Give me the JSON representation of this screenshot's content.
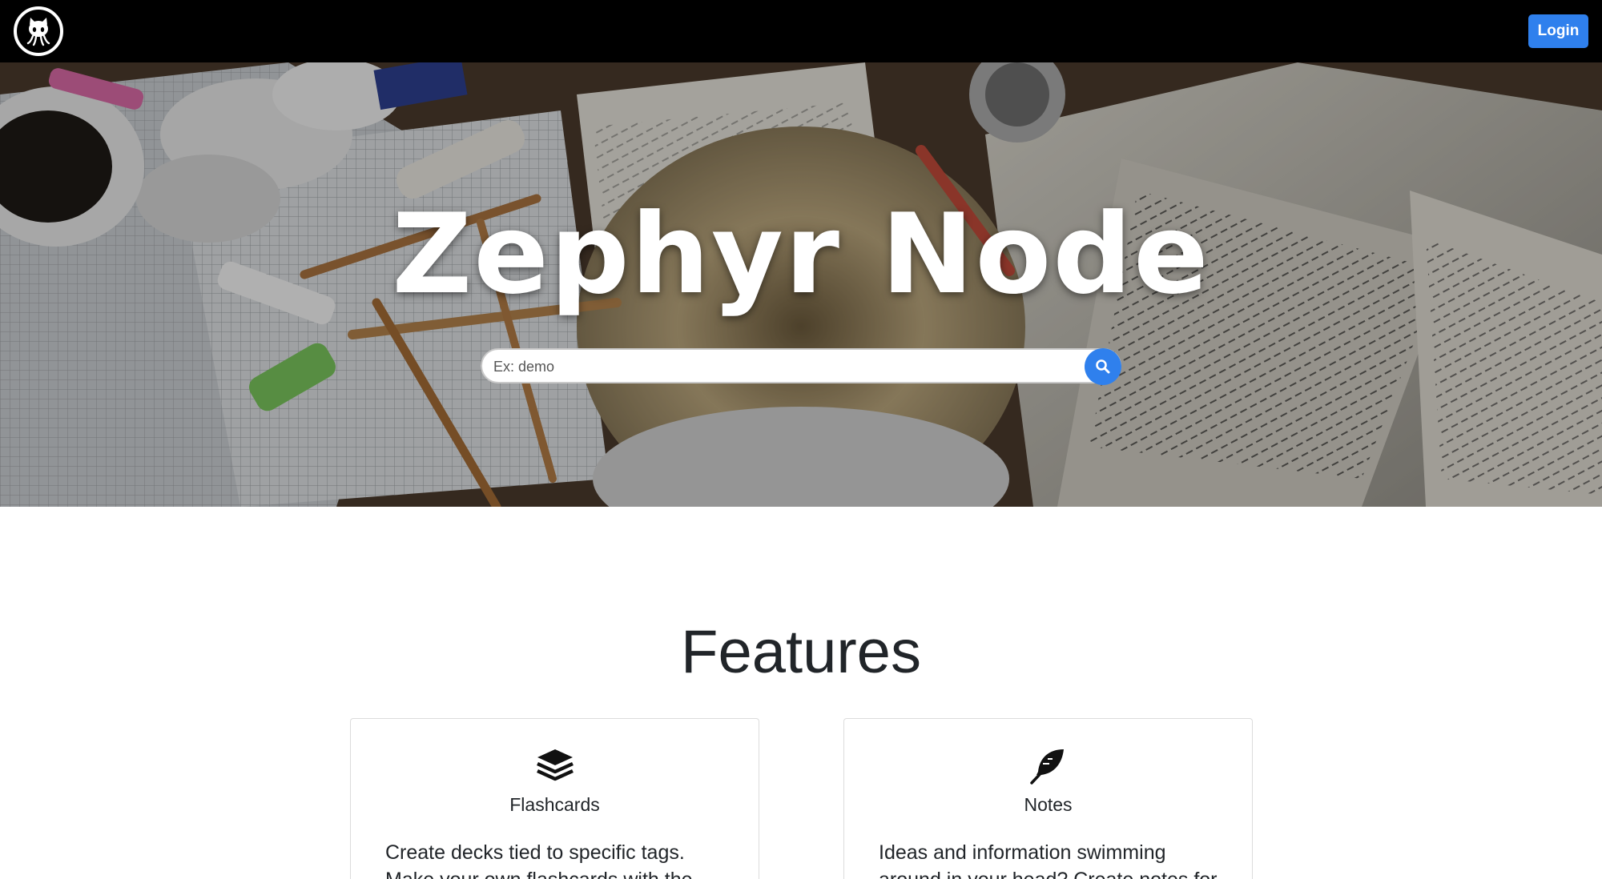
{
  "navbar": {
    "logo_icon": "octocat-icon",
    "login_label": "Login"
  },
  "hero": {
    "title": "Zephyr Node",
    "search": {
      "placeholder": "Ex: demo",
      "value": "",
      "button_icon": "search-icon"
    }
  },
  "features": {
    "heading": "Features",
    "cards": [
      {
        "icon": "layers-icon",
        "title": "Flashcards",
        "text": "Create decks tied to specific tags. Make your own flashcards with the"
      },
      {
        "icon": "feather-icon",
        "title": "Notes",
        "text": "Ideas and information swimming around in your head? Create notes for"
      }
    ]
  },
  "colors": {
    "navbar_bg": "#000000",
    "accent": "#2f80ed",
    "hero_text": "#ffffff"
  }
}
